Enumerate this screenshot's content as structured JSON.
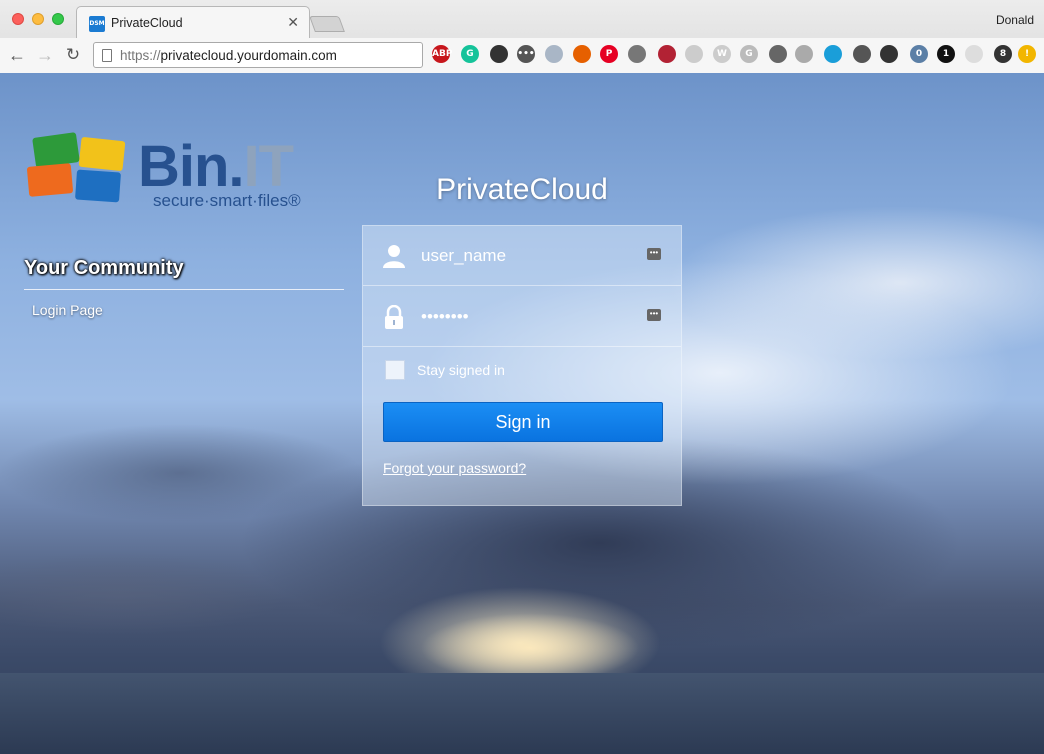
{
  "browser": {
    "tab_title": "PrivateCloud",
    "tab_favicon": "DSM",
    "profile_name": "Donald",
    "url_protocol": "https://",
    "url_host": "privatecloud.yourdomain.com",
    "extensions": [
      {
        "name": "abp-icon",
        "label": "ABP",
        "color": "#c7161c"
      },
      {
        "name": "grammarly-icon",
        "label": "G",
        "color": "#15c39a"
      },
      {
        "name": "owl-icon",
        "label": "",
        "color": "#333333"
      },
      {
        "name": "dots-icon",
        "label": "•••",
        "color": "#555555"
      },
      {
        "name": "download-icon",
        "label": "",
        "color": "#a9b6c6"
      },
      {
        "name": "firefox-icon",
        "label": "",
        "color": "#e66000"
      },
      {
        "name": "pinterest-icon",
        "label": "P",
        "color": "#e60023"
      },
      {
        "name": "note-icon",
        "label": "",
        "color": "#777777"
      },
      {
        "name": "flag-icon",
        "label": "",
        "color": "#b22234"
      },
      {
        "name": "clock-icon",
        "label": "",
        "color": "#cccccc"
      },
      {
        "name": "w-icon",
        "label": "W",
        "color": "#cccccc"
      },
      {
        "name": "g-icon",
        "label": "G",
        "color": "#bbbbbb"
      },
      {
        "name": "evernote-icon",
        "label": "",
        "color": "#666666"
      },
      {
        "name": "cast-icon",
        "label": "",
        "color": "#aaaaaa"
      },
      {
        "name": "crop-icon",
        "label": "",
        "color": "#1a9ed9"
      },
      {
        "name": "film-icon",
        "label": "",
        "color": "#555555"
      },
      {
        "name": "snowflake-icon",
        "label": "",
        "color": "#333333"
      },
      {
        "name": "chart-icon",
        "label": "0",
        "color": "#5b7fa6"
      },
      {
        "name": "onepassword-icon",
        "label": "1",
        "color": "#111111"
      },
      {
        "name": "page-icon-ext",
        "label": "",
        "color": "#dddddd"
      },
      {
        "name": "badge-icon",
        "label": "8",
        "color": "#333333"
      },
      {
        "name": "warning-icon",
        "label": "!",
        "color": "#f2b600"
      }
    ]
  },
  "page": {
    "logo_main": "Bin.",
    "logo_it": "IT",
    "logo_tagline": "secure·smart·files®",
    "app_title": "PrivateCloud",
    "community_title": "Your Community",
    "community_link": "Login Page",
    "login": {
      "username_value": "user_name",
      "password_value": "••••••••",
      "stay_signed_in": "Stay signed in",
      "sign_in_label": "Sign in",
      "forgot_label": "Forgot your password?"
    }
  }
}
